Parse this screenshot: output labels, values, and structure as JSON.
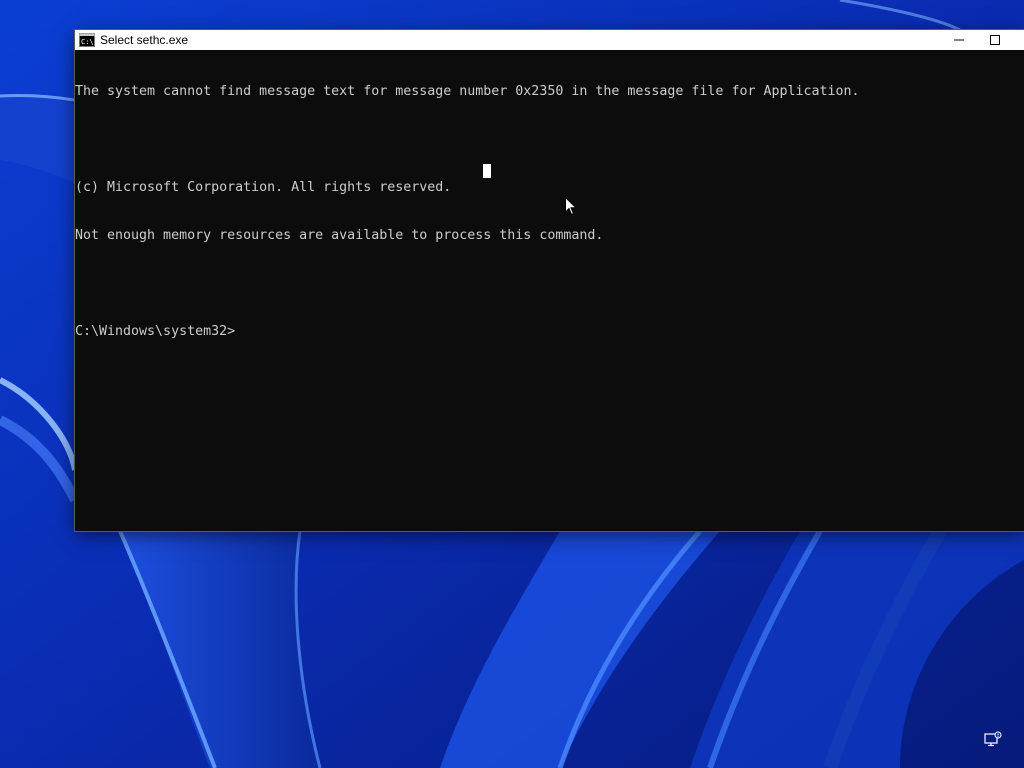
{
  "window": {
    "title": "Select sethc.exe",
    "icon": "cmd-icon",
    "controls": [
      "minimize-icon",
      "maximize-icon"
    ]
  },
  "console": {
    "lines": [
      "The system cannot find message text for message number 0x2350 in the message file for Application.",
      "",
      "(c) Microsoft Corporation. All rights reserved.",
      "Not enough memory resources are available to process this command.",
      "",
      "C:\\Windows\\system32>"
    ]
  },
  "taskbar": {
    "tray_icons": [
      "network-icon"
    ]
  },
  "colors": {
    "console_background": "#0c0c0c",
    "console_text": "#cccccc",
    "title_bar": "#ffffff",
    "wallpaper": "#0a2fae"
  }
}
